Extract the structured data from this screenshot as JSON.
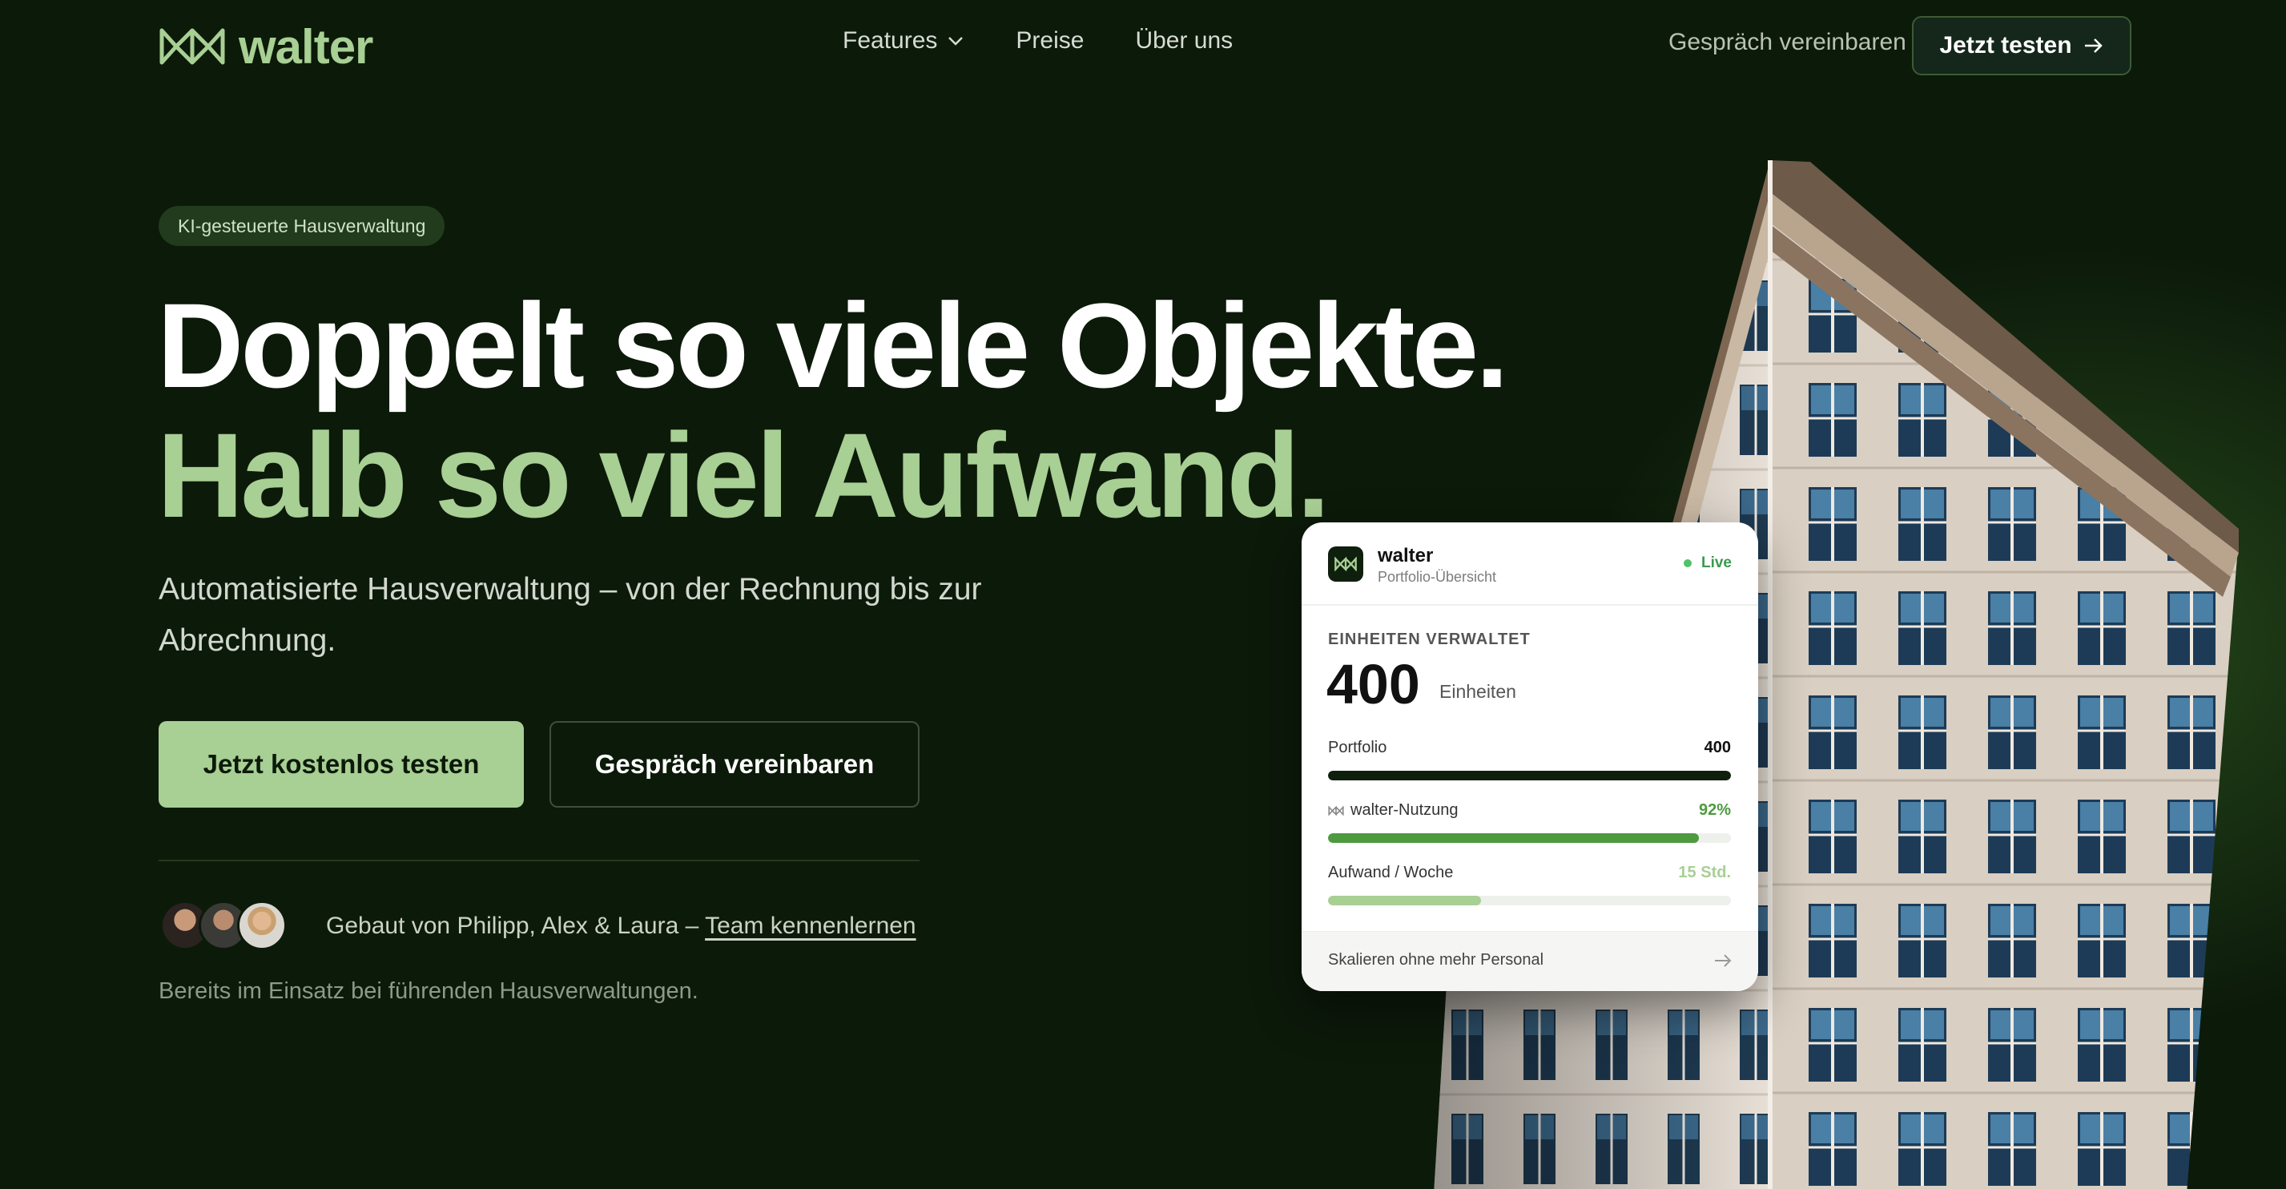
{
  "brand": {
    "name": "walter",
    "accent": "#a8cf94",
    "background": "#0c1a0a"
  },
  "nav": {
    "links": [
      {
        "label": "Features",
        "has_dropdown": true
      },
      {
        "label": "Preise"
      },
      {
        "label": "Über uns"
      }
    ],
    "secondary_link": "Gespräch vereinbaren",
    "cta_label": "Jetzt testen"
  },
  "hero": {
    "badge": "KI-gesteuerte Hausverwaltung",
    "headline_line1": "Doppelt so viele Objekte.",
    "headline_line2": "Halb so viel Aufwand.",
    "subheadline": "Automatisierte Hausverwaltung – von der Rechnung bis zur Abrechnung.",
    "primary_button": "Jetzt kostenlos testen",
    "secondary_button": "Gespräch vereinbaren",
    "built_by_text": "Gebaut von Philipp, Alex & Laura – ",
    "built_by_link": "Team kennenlernen",
    "trust_line": "Bereits im Einsatz bei führenden Hausverwaltungen."
  },
  "card": {
    "title": "walter",
    "subtitle": "Portfolio-Übersicht",
    "status": "Live",
    "metric_label": "EINHEITEN VERWALTET",
    "metric_value": "400",
    "metric_unit": "Einheiten",
    "rows": [
      {
        "label": "Portfolio",
        "value": "400",
        "fill_fraction": 1.0,
        "color": "#0f1f0d",
        "value_color": "#111111"
      },
      {
        "label": "walter-Nutzung",
        "value": "92%",
        "fill_fraction": 0.92,
        "color": "#4e9a3f",
        "value_color": "#4e9a3f",
        "icon": "walter-logo-icon"
      },
      {
        "label": "Aufwand / Woche",
        "value": "15 Std.",
        "fill_fraction": 0.38,
        "color": "#a8cf94",
        "value_color": "#a8cf94"
      }
    ],
    "footer": "Skalieren ohne mehr Personal"
  }
}
